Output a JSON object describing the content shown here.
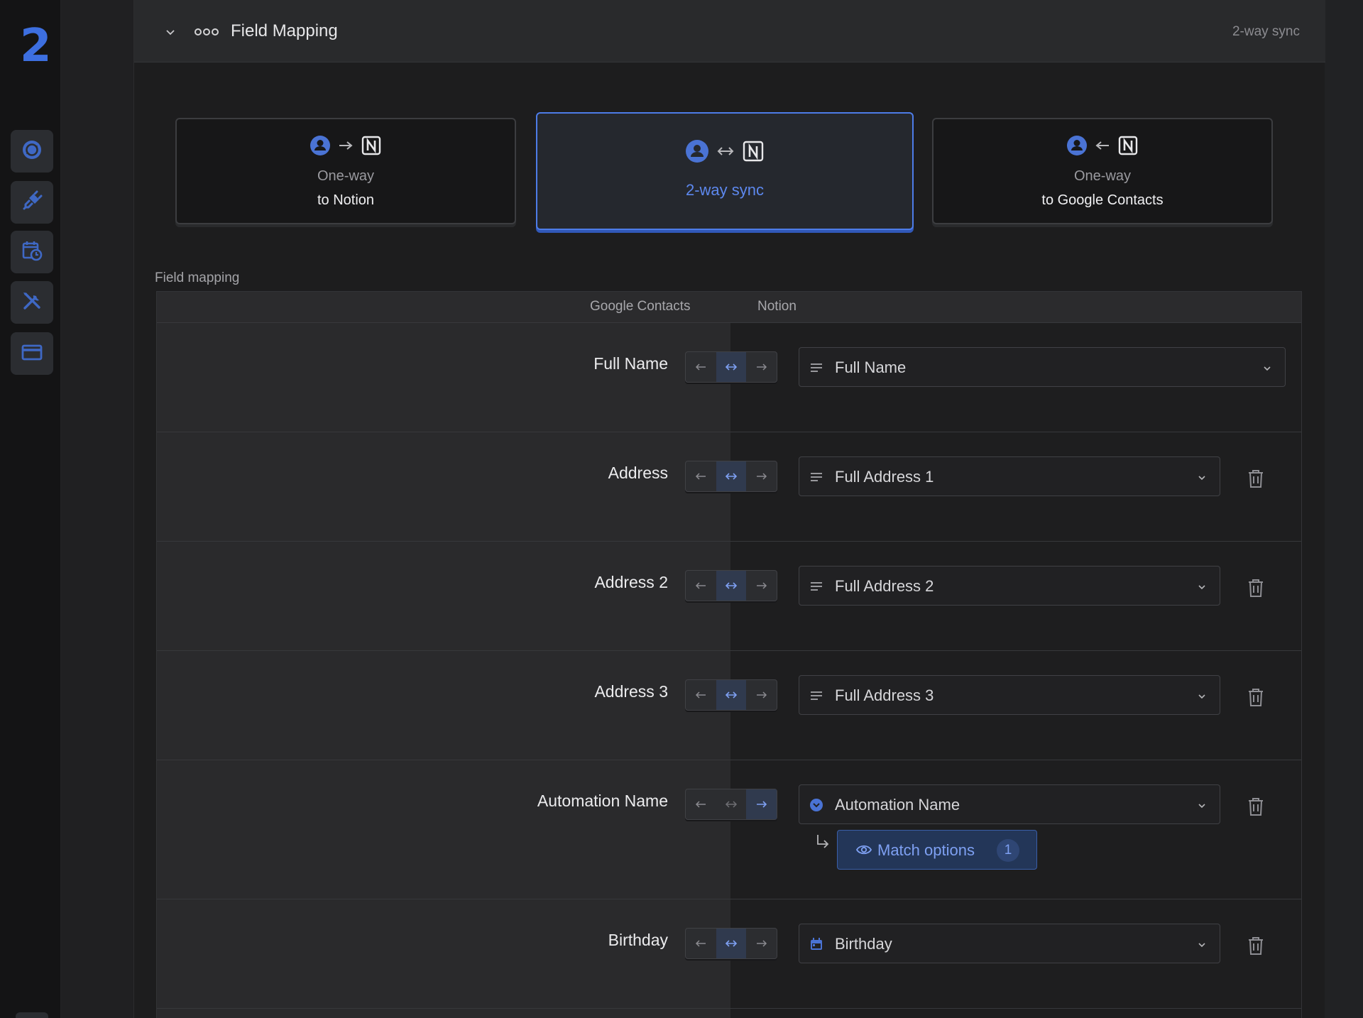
{
  "app": {
    "logo": "2"
  },
  "sidebar": {
    "items": [
      {
        "icon": "sync-icon"
      },
      {
        "icon": "plug-icon"
      },
      {
        "icon": "calendar-clock-icon"
      },
      {
        "icon": "tools-icon"
      },
      {
        "icon": "credit-card-icon"
      }
    ]
  },
  "header": {
    "title": "Field Mapping",
    "mode": "2-way sync"
  },
  "modes": [
    {
      "line1": "One-way",
      "line2": "to Notion",
      "direction": "to-notion",
      "active": false
    },
    {
      "line1": "",
      "line2": "2-way sync",
      "direction": "both",
      "active": true
    },
    {
      "line1": "One-way",
      "line2": "to Google Contacts",
      "direction": "to-google",
      "active": false
    }
  ],
  "mapping": {
    "section_label": "Field mapping",
    "columns": {
      "left": "Google Contacts",
      "right": "Notion"
    },
    "rows": [
      {
        "field": "Full Name",
        "direction": "both",
        "target": "Full Name",
        "target_icon": "text-lines-icon",
        "deletable": false
      },
      {
        "field": "Address",
        "direction": "both",
        "target": "Full Address 1",
        "target_icon": "text-lines-icon",
        "deletable": true
      },
      {
        "field": "Address 2",
        "direction": "both",
        "target": "Full Address 2",
        "target_icon": "text-lines-icon",
        "deletable": true
      },
      {
        "field": "Address 3",
        "direction": "both",
        "target": "Full Address 3",
        "target_icon": "text-lines-icon",
        "deletable": true
      },
      {
        "field": "Automation Name",
        "direction": "to-notion",
        "target": "Automation Name",
        "target_icon": "select-circle-icon",
        "deletable": true,
        "match_options": {
          "label": "Match options",
          "count": "1"
        }
      },
      {
        "field": "Birthday",
        "direction": "both",
        "target": "Birthday",
        "target_icon": "calendar-icon",
        "deletable": true
      }
    ]
  },
  "colors": {
    "accent": "#4d7ce8",
    "accent_text": "#5d88ee",
    "background": "#1d1d1e"
  }
}
